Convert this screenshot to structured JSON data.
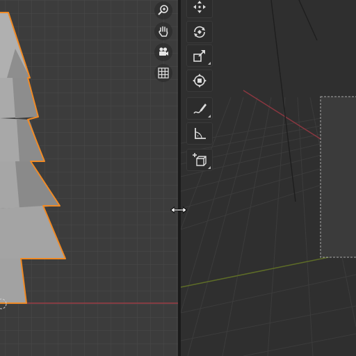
{
  "viewport_left": {
    "background": "#3c3c3c",
    "grid_color": "#4a4a4a",
    "axis_x_color": "#9b3c44",
    "object": {
      "fill": "#a6a6a6",
      "outline": "#f08a25"
    },
    "nav_gizmos": [
      {
        "name": "zoom-icon"
      },
      {
        "name": "hand-pan-icon"
      },
      {
        "name": "camera-icon"
      },
      {
        "name": "grid-view-icon"
      }
    ]
  },
  "viewport_right": {
    "background": "#2f2f2f",
    "grid_color": "#3a3a3a",
    "axis_x_color": "#9b3c44",
    "axis_y_color": "#6a7a2a",
    "toolbar": [
      {
        "name": "move-tool-icon"
      },
      {
        "name": "rotate-tool-icon"
      },
      {
        "name": "scale-tool-icon"
      },
      {
        "name": "transform-tool-icon"
      },
      {
        "name": "annotate-tool-icon"
      },
      {
        "name": "measure-tool-icon"
      },
      {
        "name": "add-cube-tool-icon"
      }
    ]
  },
  "cursor": {
    "name": "horizontal-resize-cursor"
  }
}
